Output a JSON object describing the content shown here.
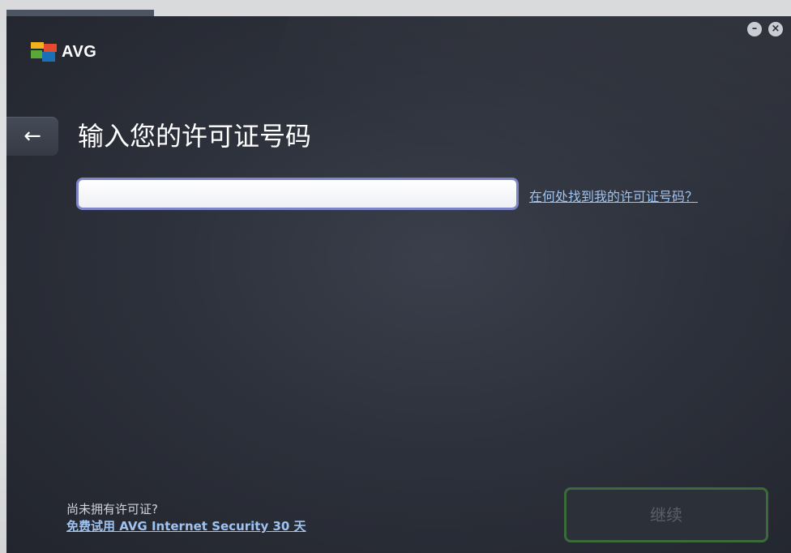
{
  "app": {
    "logo_text": "AVG"
  },
  "window_controls": {
    "minimize_icon": "minimize-icon",
    "close_icon": "close-icon",
    "minimize_glyph": "–",
    "close_glyph": "×"
  },
  "header": {
    "back_glyph": "←",
    "title": "输入您的许可证号码"
  },
  "license": {
    "value": "",
    "placeholder": "",
    "help_link": "在何处找到我的许可证号码？"
  },
  "footer": {
    "no_license_text": "尚未拥有许可证?",
    "trial_link": "免费试用 AVG Internet Security 30 天",
    "continue_label": "继续"
  },
  "colors": {
    "background": "#2d313b",
    "link": "#9fc3f0",
    "input_border": "#7f86c8",
    "continue_border": "#3c6b3b"
  }
}
